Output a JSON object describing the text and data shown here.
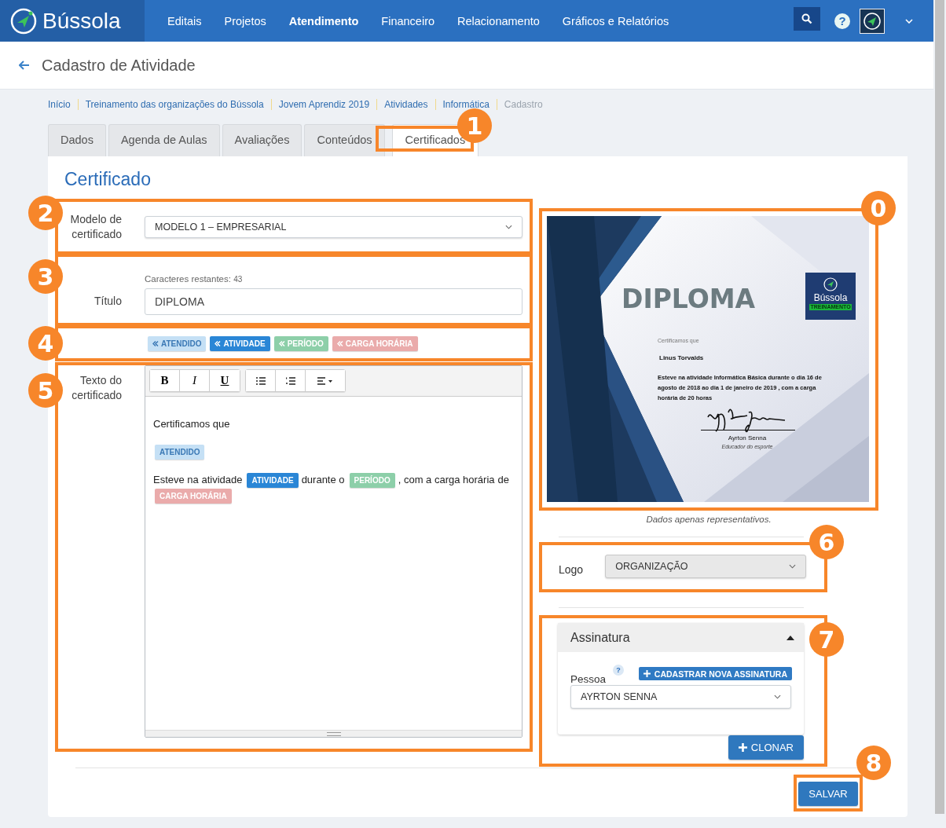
{
  "nav": {
    "brand": "Bússola",
    "items": [
      {
        "label": "Editais",
        "selected": false
      },
      {
        "label": "Projetos",
        "selected": false
      },
      {
        "label": "Atendimento",
        "selected": true
      },
      {
        "label": "Financeiro",
        "selected": false
      },
      {
        "label": "Relacionamento",
        "selected": false
      },
      {
        "label": "Gráficos e Relatórios",
        "selected": false
      }
    ],
    "help": "?"
  },
  "header": {
    "title": "Cadastro de Atividade"
  },
  "breadcrumbs": [
    {
      "label": "Início",
      "current": false
    },
    {
      "label": "Treinamento das organizações do Bússola",
      "current": false
    },
    {
      "label": "Jovem Aprendiz 2019",
      "current": false
    },
    {
      "label": "Atividades",
      "current": false
    },
    {
      "label": "Informática",
      "current": false
    },
    {
      "label": "Cadastro",
      "current": true
    }
  ],
  "tabs": [
    {
      "label": "Dados",
      "selected": false
    },
    {
      "label": "Agenda de Aulas",
      "selected": false
    },
    {
      "label": "Avaliações",
      "selected": false
    },
    {
      "label": "Conteúdos",
      "selected": false
    },
    {
      "label": "Certificados",
      "selected": true
    }
  ],
  "section_title": "Certificado",
  "model": {
    "label": "Modelo de certificado",
    "value": "MODELO 1 – EMPRESARIAL"
  },
  "title_field": {
    "counter_label": "Caracteres restantes:",
    "counter": "43",
    "label": "Título",
    "value": "DIPLOMA"
  },
  "tags": [
    {
      "label": "ATENDIDO",
      "color": "#c5e0f5"
    },
    {
      "label": "ATIVIDADE",
      "color": "#2a86d6"
    },
    {
      "label": "PERÍODO",
      "color": "#8dcfa9"
    },
    {
      "label": "CARGA HORÁRIA",
      "color": "#eaabab"
    }
  ],
  "editor": {
    "label": "Texto do certificado",
    "toolbar": [
      "B",
      "I",
      "U"
    ],
    "paragraphs": [
      [
        {
          "kind": "text",
          "text": "Certificamos que"
        }
      ],
      [
        {
          "kind": "tag",
          "text": "ATENDIDO",
          "color": "#c5e0f5"
        }
      ],
      [
        {
          "kind": "text",
          "text": "Esteve na atividade"
        },
        {
          "kind": "tag",
          "text": "ATIVIDADE",
          "color": "#2a86d6"
        },
        {
          "kind": "text",
          "text": "durante o"
        },
        {
          "kind": "tag",
          "text": "PERÍODO",
          "color": "#8dcfa9"
        },
        {
          "kind": "text",
          "text": ", com a carga horária"
        },
        {
          "kind": "text",
          "text": "de"
        },
        {
          "kind": "tag",
          "text": "CARGA HORÁRIA",
          "color": "#eaabab"
        }
      ]
    ]
  },
  "preview": {
    "heading": "DIPLOMA",
    "logo_name": "Bússola",
    "logo_badge": "TREINAMENTO",
    "intro": "Certificamos que",
    "person": "Linus Torvalds",
    "body": "Esteve na atividade  Informática Básica  durante o  dia 16 de agosto de 2018 ao dia 1 de janeiro de 2019  , com a carga horária de  20 horas",
    "signer": "Ayrton Senna",
    "signer_role": "Educador do esporte",
    "caption": "Dados apenas representativos."
  },
  "logo": {
    "label": "Logo",
    "value": "ORGANIZAÇÃO"
  },
  "signature": {
    "title": "Assinatura",
    "expanded": true,
    "person_label": "Pessoa",
    "help": "?",
    "add_button": "CADASTRAR NOVA ASSINATURA",
    "value": "AYRTON SENNA",
    "clone_button": "CLONAR"
  },
  "save_button": "SALVAR",
  "annotations": {
    "preview": "0",
    "tabs": "1",
    "model": "2",
    "title": "3",
    "tags": "4",
    "text": "5",
    "logo": "6",
    "signature": "7",
    "save": "8"
  }
}
